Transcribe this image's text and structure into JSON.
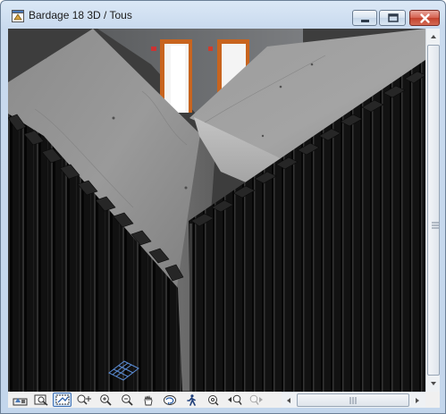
{
  "window": {
    "title": "Bardage 18 3D / Tous",
    "app_icon": "archicad-window-icon",
    "controls": [
      "minimize-icon",
      "maximize-icon",
      "close-icon"
    ]
  },
  "viewport": {
    "content": "3d-model-view",
    "grid_marker_icon": "grid-plane-icon"
  },
  "toolbar": {
    "buttons": [
      {
        "name": "select-view-icon",
        "active": false
      },
      {
        "name": "fit-in-window-icon",
        "active": false
      },
      {
        "name": "marquee-zoom-icon",
        "active": true
      },
      {
        "name": "zoom-to-selection-icon",
        "active": false
      },
      {
        "name": "zoom-in-icon",
        "active": false
      },
      {
        "name": "zoom-out-icon",
        "active": false
      },
      {
        "name": "pan-icon",
        "active": false
      },
      {
        "name": "orbit-icon",
        "active": false
      },
      {
        "name": "walk-explore-icon",
        "active": false
      },
      {
        "name": "zoom-previous-icon",
        "active": false
      },
      {
        "name": "zoom-back-icon",
        "active": false
      },
      {
        "name": "zoom-forward-icon",
        "active": false
      }
    ]
  },
  "colors": {
    "frame": "#c3d6ec",
    "concrete": "#8f8f8f",
    "cladding": "#121212",
    "door_frame": "#c8641e"
  }
}
